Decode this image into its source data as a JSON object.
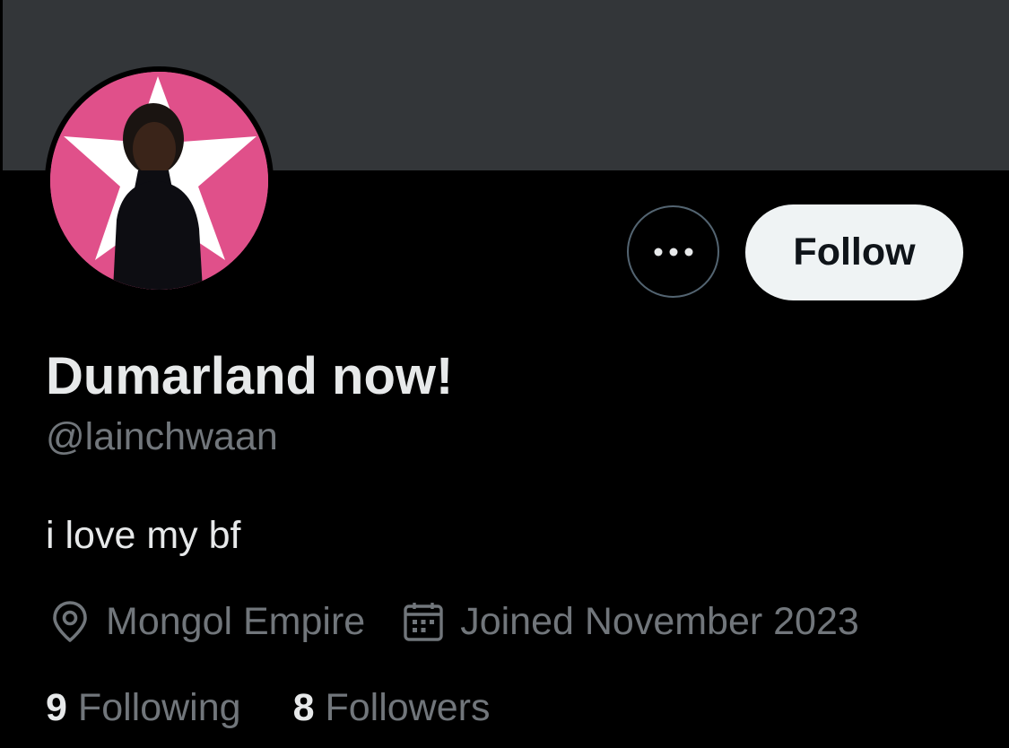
{
  "profile": {
    "display_name": "Dumarland now!",
    "handle": "@lainchwaan",
    "bio": "i love my bf",
    "location": "Mongol Empire",
    "joined": "Joined November 2023"
  },
  "actions": {
    "more_icon": "more-horizontal-icon",
    "follow_label": "Follow"
  },
  "stats": {
    "following_count": "9",
    "following_label": "Following",
    "followers_count": "8",
    "followers_label": "Followers"
  },
  "icons": {
    "location": "location-pin-icon",
    "joined": "calendar-icon"
  },
  "colors": {
    "background": "#000000",
    "banner": "#333639",
    "primary_text": "#e7e9ea",
    "secondary_text": "#71767b",
    "follow_button_bg": "#eff3f4",
    "avatar_pink": "#e0508a"
  }
}
